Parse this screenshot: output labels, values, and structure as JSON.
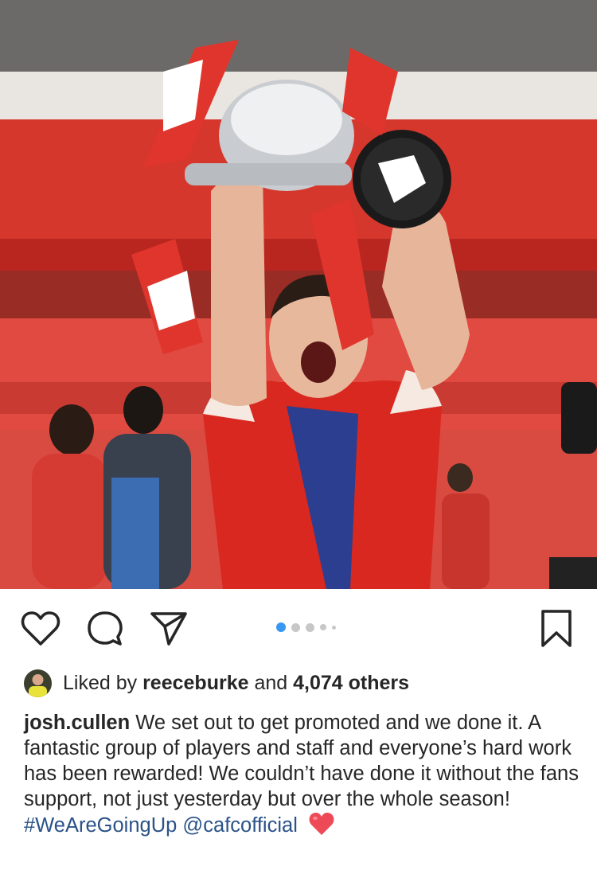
{
  "post": {
    "image_alt": "Player celebrating with trophy in stadium",
    "carousel": {
      "count": 5,
      "active_index": 0
    },
    "icons": {
      "like": "heart-outline-icon",
      "comment": "comment-bubble-icon",
      "share": "paper-plane-icon",
      "save": "bookmark-icon"
    }
  },
  "likes": {
    "prefix": "Liked by",
    "user": "reeceburke",
    "connector": "and",
    "others": "4,074 others"
  },
  "caption": {
    "username": "josh.cullen",
    "text": "We set out to get promoted and we done it. A fantastic group of players and staff and everyone’s hard work has been rewarded! We couldn’t have done it without the fans support, not just yesterday but over the whole season!",
    "hashtag": "#WeAreGoingUp",
    "mention": "@cafcofficial"
  },
  "colors": {
    "accent": "#3897f0",
    "link": "#2a5288",
    "text": "#262626",
    "heart": "#ed4956"
  }
}
